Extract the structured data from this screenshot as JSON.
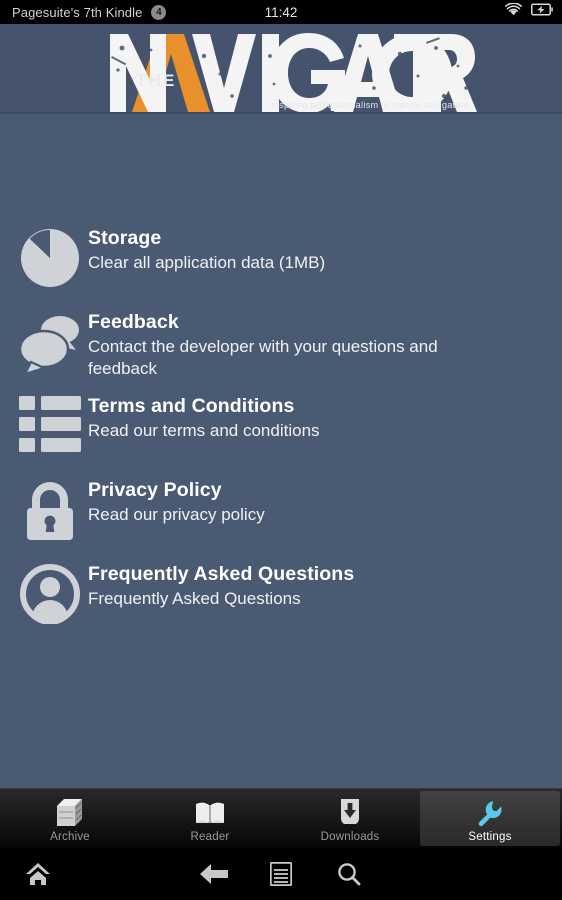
{
  "status_bar": {
    "device_name": "Pagesuite's 7th Kindle",
    "notification_count": "4",
    "time": "11:42",
    "wifi_icon": "wifi-icon",
    "battery_icon": "battery-charging-icon"
  },
  "header": {
    "logo_the": "THE",
    "logo_main": "NAVIGATOR",
    "tagline": "Inspiring professionalism in marine navigators",
    "logo_accent_color": "#e8902c",
    "background_color": "#45546c"
  },
  "theme": {
    "content_background": "#4b5a73",
    "icon_color": "#cfd2d6",
    "active_tab_accent": "#5bc8e8"
  },
  "settings": {
    "items": [
      {
        "icon": "storage-pie-icon",
        "title": "Storage",
        "subtitle": "Clear all application data (1MB)"
      },
      {
        "icon": "feedback-speech-bubbles-icon",
        "title": "Feedback",
        "subtitle": "Contact the developer with your questions and feedback"
      },
      {
        "icon": "terms-list-icon",
        "title": "Terms and Conditions",
        "subtitle": "Read our terms and conditions"
      },
      {
        "icon": "privacy-lock-icon",
        "title": "Privacy Policy",
        "subtitle": "Read our privacy policy"
      },
      {
        "icon": "faq-person-icon",
        "title": "Frequently Asked Questions",
        "subtitle": "Frequently Asked Questions"
      }
    ]
  },
  "tab_bar": {
    "tabs": [
      {
        "icon": "archive-cabinet-icon",
        "label": "Archive",
        "active": false
      },
      {
        "icon": "reader-book-icon",
        "label": "Reader",
        "active": false
      },
      {
        "icon": "downloads-arrow-icon",
        "label": "Downloads",
        "active": false
      },
      {
        "icon": "settings-wrench-icon",
        "label": "Settings",
        "active": true
      }
    ]
  },
  "nav_bar": {
    "home_icon": "home-icon",
    "back_icon": "back-arrow-icon",
    "menu_icon": "menu-icon",
    "search_icon": "search-icon"
  }
}
